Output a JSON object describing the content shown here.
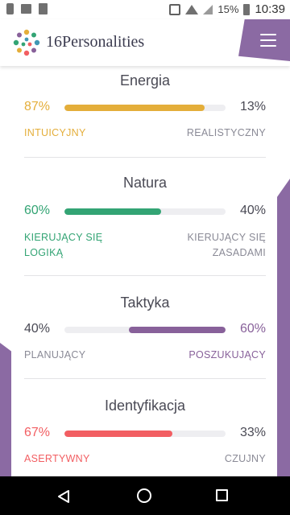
{
  "status_bar": {
    "battery": "15%",
    "time": "10:39"
  },
  "header": {
    "brand": "16Personalities"
  },
  "colors": {
    "energia": "#e4ae3a",
    "natura": "#33a474",
    "taktyka": "#88619a",
    "identyfikacja": "#f25e62",
    "accent_purple": "#8b6aa3"
  },
  "traits": [
    {
      "title": "Energia",
      "left_percent": "87%",
      "right_percent": "13%",
      "left_label": "INTUICYJNY",
      "right_label": "REALISTYCZNY",
      "fill_fraction": 0.87,
      "dominant": "left"
    },
    {
      "title": "Natura",
      "left_percent": "60%",
      "right_percent": "40%",
      "left_label_line1": "KIERUJĄCY SIĘ",
      "left_label_line2": "LOGIKĄ",
      "right_label_line1": "KIERUJĄCY SIĘ",
      "right_label_line2": "ZASADAMI",
      "fill_fraction": 0.6,
      "dominant": "left"
    },
    {
      "title": "Taktyka",
      "left_percent": "40%",
      "right_percent": "60%",
      "left_label": "PLANUJĄCY",
      "right_label": "POSZUKUJĄCY",
      "fill_fraction": 0.6,
      "dominant": "right"
    },
    {
      "title": "Identyfikacja",
      "left_percent": "67%",
      "right_percent": "33%",
      "left_label": "ASERTYWNY",
      "right_label": "CZUJNY",
      "fill_fraction": 0.67,
      "dominant": "left"
    }
  ]
}
